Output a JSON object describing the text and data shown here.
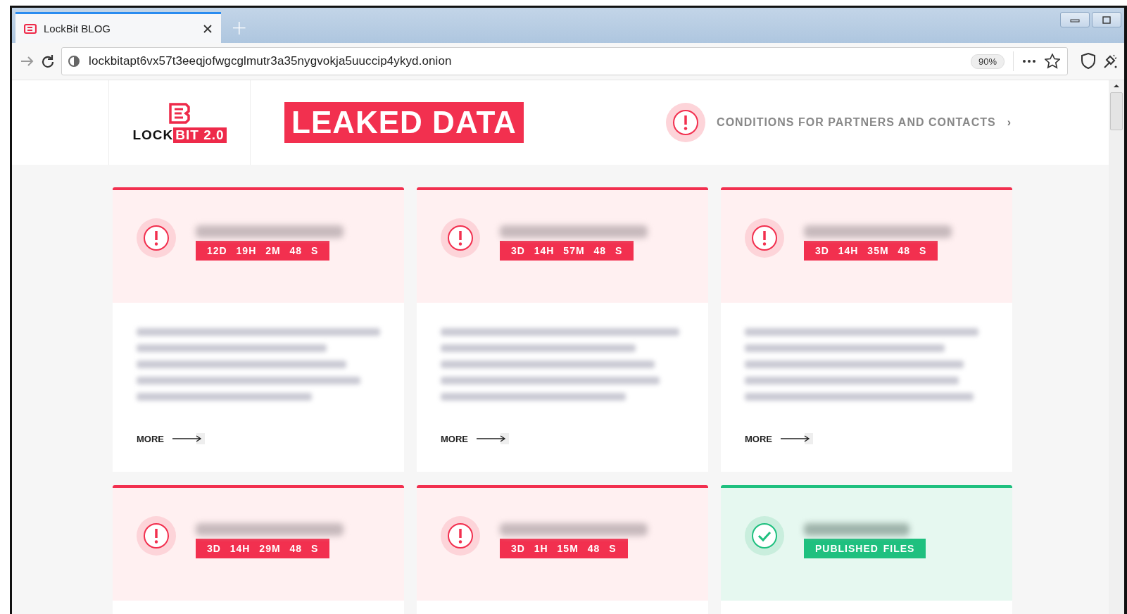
{
  "browser": {
    "tab": {
      "title": "LockBit BLOG",
      "selected": true
    },
    "new_tab": "+",
    "address": "lockbitapt6vx57t3eeqjofwgcglmutr3a35nygvokja5uuccip4ykyd.onion",
    "zoom": "90%"
  },
  "header": {
    "logo": {
      "word_1": "LOCK",
      "word_2": "BIT 2.0"
    },
    "banner": "LEAKED DATA",
    "conditions_link": "CONDITIONS FOR PARTNERS AND CONTACTS",
    "link_arrow": "›"
  },
  "cards": [
    {
      "kind": "countdown",
      "badge": "12D 19H 2M 48 S",
      "more": "MORE"
    },
    {
      "kind": "countdown",
      "badge": "3D 14H 57M 48 S",
      "more": "MORE"
    },
    {
      "kind": "countdown",
      "badge": "3D 14H 35M 48 S",
      "more": "MORE"
    },
    {
      "kind": "countdown",
      "badge": "3D 14H 29M 48 S"
    },
    {
      "kind": "countdown",
      "badge": "3D 1H 15M 48 S"
    },
    {
      "kind": "published",
      "badge": "PUBLISHED FILES"
    }
  ]
}
